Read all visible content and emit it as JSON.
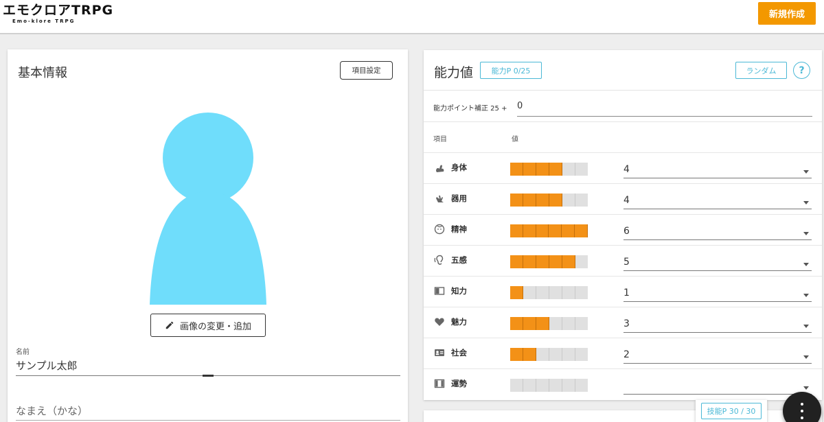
{
  "header": {
    "logo_main": "エモクロアTRPG",
    "logo_sub": "Emo-klore TRPG",
    "new_button": "新規作成",
    "accent_color": "#f39800"
  },
  "basic_info": {
    "title": "基本情報",
    "item_settings_button": "項目設定",
    "change_image_button": "画像の変更・追加",
    "name_label": "名前",
    "name_value": "サンプル太郎",
    "kana_placeholder": "なまえ（かな）",
    "avatar_color": "#6fddfb"
  },
  "abilities": {
    "title": "能力値",
    "points_badge": "能力P 0/25",
    "random_button": "ランダム",
    "help_button": "?",
    "correction_label": "能力ポイント補正 25 +",
    "correction_value": "0",
    "column_item": "項目",
    "column_value": "値",
    "bar_max": 6,
    "rows": [
      {
        "name": "身体",
        "value": "4",
        "level": 4,
        "icon": "arm-icon"
      },
      {
        "name": "器用",
        "value": "4",
        "level": 4,
        "icon": "hand-icon"
      },
      {
        "name": "精神",
        "value": "6",
        "level": 6,
        "icon": "face-icon"
      },
      {
        "name": "五感",
        "value": "5",
        "level": 5,
        "icon": "ear-icon"
      },
      {
        "name": "知力",
        "value": "1",
        "level": 1,
        "icon": "book-icon"
      },
      {
        "name": "魅力",
        "value": "3",
        "level": 3,
        "icon": "heart-icon"
      },
      {
        "name": "社会",
        "value": "2",
        "level": 2,
        "icon": "id-card-icon"
      },
      {
        "name": "運勢",
        "value": "",
        "level": 0,
        "icon": "dice-icon"
      }
    ]
  },
  "skills": {
    "points_badge": "技能P 30 / 30"
  },
  "theme": {
    "bar_on": "#f39117",
    "bar_off": "#e0e0e0",
    "link_blue": "#4ab8d6"
  }
}
